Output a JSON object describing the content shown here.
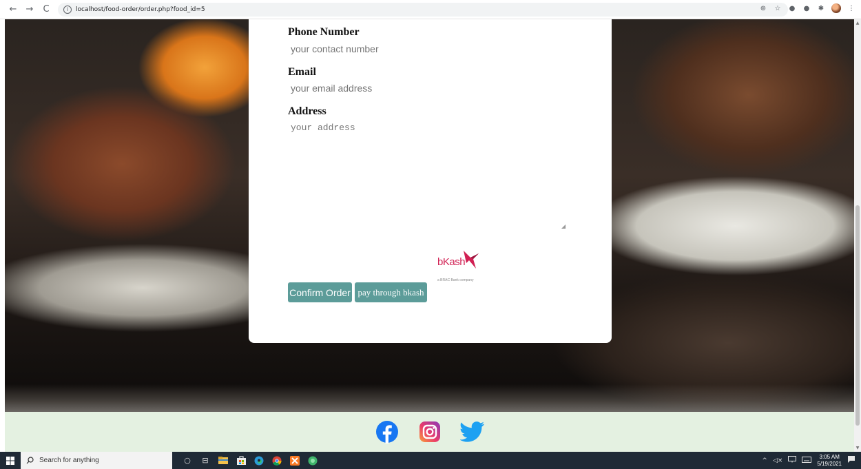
{
  "browser": {
    "url": "localhost/food-order/order.php?food_id=5",
    "back_icon": "←",
    "forward_icon": "→",
    "reload_icon": "C",
    "info_icon": "i",
    "extensions": [
      "⊕",
      "☆",
      "●",
      "●",
      "✱"
    ],
    "menu_icon": "⋮"
  },
  "form": {
    "phone": {
      "label": "Phone Number",
      "placeholder": "your contact number"
    },
    "email": {
      "label": "Email",
      "placeholder": "your email address"
    },
    "address": {
      "label": "Address",
      "placeholder": "your address"
    },
    "confirm_label": "Confirm Order",
    "bkash_label": "pay through bkash"
  },
  "bkash_logo": {
    "wordmark": "bKash",
    "tagline": "a BRAC Bank company",
    "color": "#d12053"
  },
  "footer": {
    "background": "#e4f1e1",
    "icons": [
      "facebook-icon",
      "instagram-icon",
      "twitter-icon"
    ]
  },
  "taskbar": {
    "search_placeholder": "Search for anything",
    "tray_caret": "^",
    "tray_volume": "◁×",
    "time": "3:05 AM",
    "date": "5/19/2021"
  },
  "colors": {
    "button": "#5c9c99",
    "footer": "#e4f1e1",
    "taskbar": "#1f2a36"
  }
}
